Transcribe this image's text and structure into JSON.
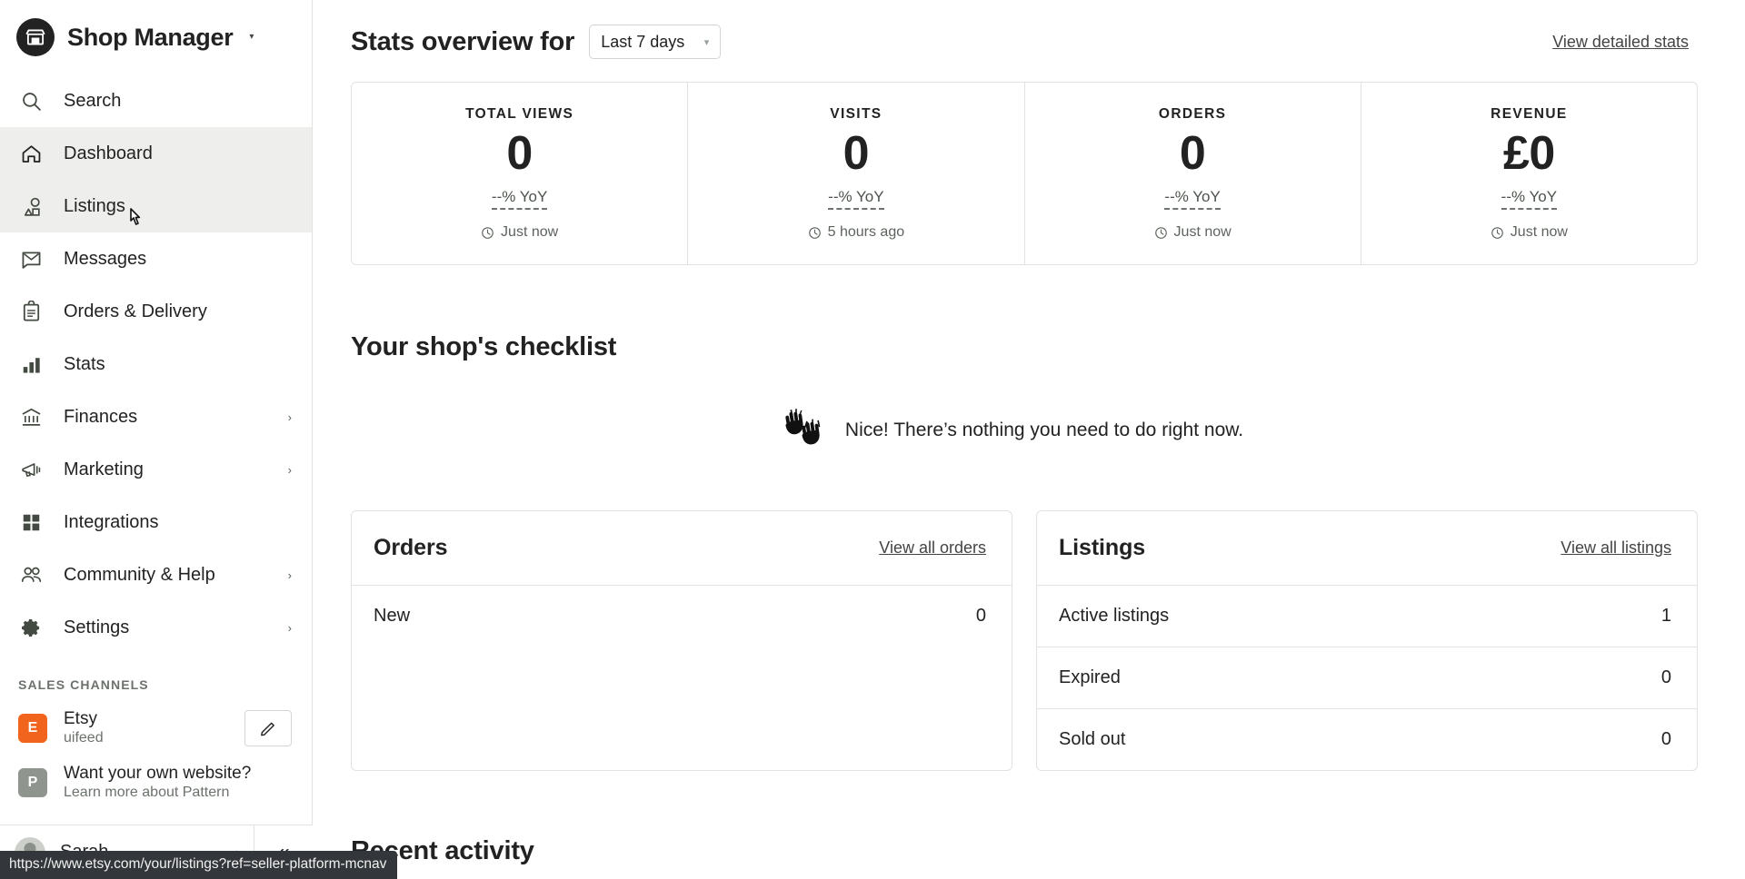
{
  "sidebar": {
    "brand": {
      "title": "Shop Manager",
      "icon": "etsy-shop-icon",
      "caret": "▾"
    },
    "items": [
      {
        "label": "Search",
        "icon": "search-icon",
        "state": "default",
        "chevron": false
      },
      {
        "label": "Dashboard",
        "icon": "home-icon",
        "state": "active",
        "chevron": false
      },
      {
        "label": "Listings",
        "icon": "listings-icon",
        "state": "hovered",
        "chevron": false
      },
      {
        "label": "Messages",
        "icon": "mail-icon",
        "state": "default",
        "chevron": false
      },
      {
        "label": "Orders & Delivery",
        "icon": "clipboard-icon",
        "state": "default",
        "chevron": false
      },
      {
        "label": "Stats",
        "icon": "bar-chart-icon",
        "state": "default",
        "chevron": false
      },
      {
        "label": "Finances",
        "icon": "bank-icon",
        "state": "default",
        "chevron": true
      },
      {
        "label": "Marketing",
        "icon": "megaphone-icon",
        "state": "default",
        "chevron": true
      },
      {
        "label": "Integrations",
        "icon": "grid-icon",
        "state": "default",
        "chevron": false
      },
      {
        "label": "Community & Help",
        "icon": "people-icon",
        "state": "default",
        "chevron": true
      },
      {
        "label": "Settings",
        "icon": "gear-icon",
        "state": "default",
        "chevron": true
      }
    ],
    "chevron_glyph": "›",
    "sales_channels_heading": "Sales channels",
    "channels": [
      {
        "badge": "E",
        "badge_color": "#f1641e",
        "title": "Etsy",
        "subtitle": "uifeed",
        "has_edit": true
      },
      {
        "badge": "P",
        "badge_color": "#8f948e",
        "title": "Want your own website?",
        "subtitle": "Learn more about Pattern",
        "has_edit": false
      }
    ],
    "user": {
      "name": "Sarah",
      "caret": "▴"
    },
    "collapse_glyph": "«"
  },
  "header": {
    "title": "Stats overview for",
    "period_value": "Last 7 days",
    "period_caret": "▾",
    "detailed_link": "View detailed stats"
  },
  "stats": [
    {
      "label": "Total views",
      "value": "0",
      "yoy": "--% YoY",
      "time": "Just now"
    },
    {
      "label": "Visits",
      "value": "0",
      "yoy": "--% YoY",
      "time": "5 hours ago"
    },
    {
      "label": "Orders",
      "value": "0",
      "yoy": "--% YoY",
      "time": "Just now"
    },
    {
      "label": "Revenue",
      "value": "£0",
      "yoy": "--% YoY",
      "time": "Just now"
    }
  ],
  "checklist": {
    "title": "Your shop's checklist",
    "empty_message": "Nice! There’s nothing you need to do right now.",
    "illustration": "raising-hands-icon"
  },
  "orders_panel": {
    "title": "Orders",
    "link": "View all orders",
    "rows": [
      {
        "label": "New",
        "value": "0"
      }
    ]
  },
  "listings_panel": {
    "title": "Listings",
    "link": "View all listings",
    "rows": [
      {
        "label": "Active listings",
        "value": "1"
      },
      {
        "label": "Expired",
        "value": "0"
      },
      {
        "label": "Sold out",
        "value": "0"
      }
    ]
  },
  "recent_activity": {
    "title": "Recent activity"
  },
  "status_bar": {
    "url": "https://www.etsy.com/your/listings?ref=seller-platform-mcnav"
  }
}
